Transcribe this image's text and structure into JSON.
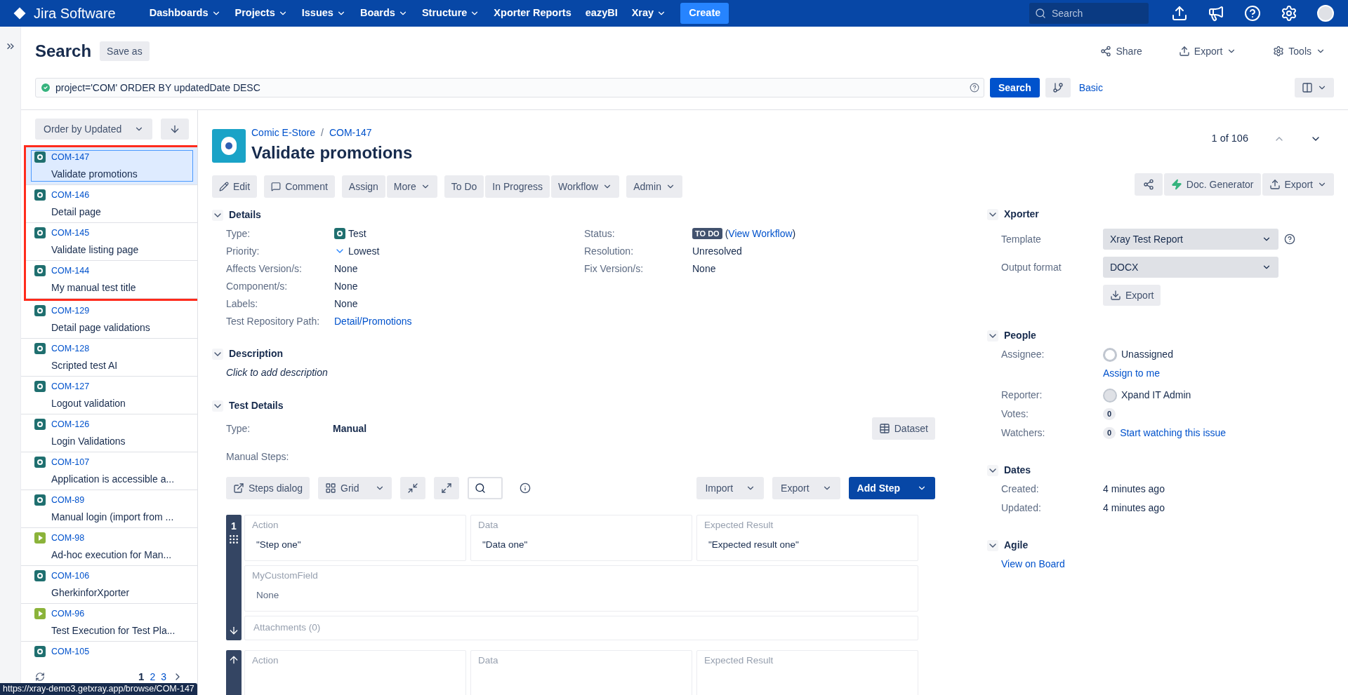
{
  "nav": {
    "logo": "Jira Software",
    "items": [
      {
        "label": "Dashboards",
        "caret": true
      },
      {
        "label": "Projects",
        "caret": true
      },
      {
        "label": "Issues",
        "caret": true
      },
      {
        "label": "Boards",
        "caret": true
      },
      {
        "label": "Structure",
        "caret": true
      },
      {
        "label": "Xporter Reports",
        "caret": false
      },
      {
        "label": "eazyBI",
        "caret": false
      },
      {
        "label": "Xray",
        "caret": true
      }
    ],
    "create": "Create",
    "search_placeholder": "Search"
  },
  "header": {
    "title": "Search",
    "save_as": "Save as",
    "share": "Share",
    "export": "Export",
    "tools": "Tools",
    "query": "project='COM' ORDER BY updatedDate DESC",
    "search_button": "Search",
    "basic": "Basic"
  },
  "list": {
    "order": "Order by Updated",
    "groups": [
      {
        "framed": true,
        "items": [
          {
            "key": "COM-147",
            "title": "Validate promotions",
            "kind": "test",
            "selected": true
          },
          {
            "key": "COM-146",
            "title": "Detail page",
            "kind": "test",
            "selected": false
          },
          {
            "key": "COM-145",
            "title": "Validate listing page",
            "kind": "test",
            "selected": false
          },
          {
            "key": "COM-144",
            "title": "My manual test title",
            "kind": "test",
            "selected": false
          }
        ]
      },
      {
        "framed": false,
        "items": [
          {
            "key": "COM-129",
            "title": "Detail page validations",
            "kind": "test",
            "selected": false
          },
          {
            "key": "COM-128",
            "title": "Scripted test AI",
            "kind": "test",
            "selected": false
          },
          {
            "key": "COM-127",
            "title": "Logout validation",
            "kind": "test",
            "selected": false
          },
          {
            "key": "COM-126",
            "title": "Login Validations",
            "kind": "test",
            "selected": false
          },
          {
            "key": "COM-107",
            "title": "Application is accessible a...",
            "kind": "test",
            "selected": false
          },
          {
            "key": "COM-89",
            "title": "Manual login (import from ...",
            "kind": "test",
            "selected": false
          },
          {
            "key": "COM-98",
            "title": "Ad-hoc execution for Man...",
            "kind": "execution",
            "selected": false
          },
          {
            "key": "COM-106",
            "title": "GherkinforXporter",
            "kind": "test",
            "selected": false
          },
          {
            "key": "COM-96",
            "title": "Test Execution for Test Pla...",
            "kind": "execution",
            "selected": false
          },
          {
            "key": "COM-105",
            "kind": "test",
            "selected": false
          }
        ]
      }
    ],
    "pages": [
      {
        "label": "1",
        "selected": true
      },
      {
        "label": "2",
        "selected": false
      },
      {
        "label": "3",
        "selected": false
      }
    ]
  },
  "issue": {
    "project": "Comic E-Store",
    "separator": "/",
    "key": "COM-147",
    "title": "Validate promotions",
    "pager": "1 of 106",
    "actions": [
      [
        {
          "label": "Edit",
          "kind": "edit",
          "caret": false
        }
      ],
      [
        {
          "label": "Comment",
          "kind": "comment",
          "caret": false
        }
      ],
      [
        {
          "label": "Assign",
          "caret": false
        },
        {
          "label": "More",
          "caret": true
        }
      ],
      [
        {
          "label": "To Do",
          "caret": false
        },
        {
          "label": "In Progress",
          "caret": false
        },
        {
          "label": "Workflow",
          "caret": true
        }
      ],
      [
        {
          "label": "Admin",
          "caret": true
        }
      ]
    ],
    "doc_generator": "Doc. Generator",
    "export": "Export",
    "details_title": "Details",
    "details_left": [
      {
        "label": "Type:",
        "value": "Test",
        "kind": "type"
      },
      {
        "label": "Priority:",
        "value": "Lowest",
        "kind": "priority"
      },
      {
        "label": "Affects Version/s:",
        "value": "None",
        "kind": "text"
      },
      {
        "label": "Component/s:",
        "value": "None",
        "kind": "text"
      },
      {
        "label": "Labels:",
        "value": "None",
        "kind": "text"
      },
      {
        "label": "Test Repository Path:",
        "value": "Detail/Promotions",
        "kind": "link"
      }
    ],
    "details_right": [
      {
        "label": "Status:",
        "value": "TO DO",
        "open": "(",
        "link": "View Workflow",
        "close": ")",
        "kind": "status"
      },
      {
        "label": "Resolution:",
        "value": "Unresolved",
        "kind": "text"
      },
      {
        "label": "Fix Version/s:",
        "value": "None",
        "kind": "text"
      }
    ],
    "description_title": "Description",
    "description": "Click to add description",
    "test_details_title": "Test Details",
    "type_label": "Type:",
    "type_value": "Manual",
    "dataset": "Dataset",
    "manual_steps": "Manual Steps:",
    "steps_toolbar": {
      "dialog": "Steps dialog",
      "grid": "Grid",
      "import": "Import",
      "export": "Export",
      "add": "Add Step"
    },
    "steps": [
      {
        "number": "1",
        "action_label": "Action",
        "action": "\"Step one\"",
        "data_label": "Data",
        "data": "\"Data one\"",
        "result_label": "Expected Result",
        "result": "\"Expected result one\"",
        "custom_label": "MyCustomField",
        "custom": "None",
        "attachments": "Attachments (0)"
      },
      {
        "action_label": "Action",
        "data_label": "Data",
        "result_label": "Expected Result"
      }
    ]
  },
  "side": {
    "xporter": {
      "title": "Xporter",
      "template_label": "Template",
      "template": "Xray Test Report",
      "format_label": "Output format",
      "format": "DOCX",
      "export": "Export"
    },
    "people": {
      "title": "People",
      "assignee_label": "Assignee:",
      "assignee": "Unassigned",
      "assign_me": "Assign to me",
      "reporter_label": "Reporter:",
      "reporter": "Xpand IT Admin",
      "votes_label": "Votes:",
      "votes": "0",
      "watchers_label": "Watchers:",
      "watchers": "0",
      "watch": "Start watching this issue"
    },
    "dates": {
      "title": "Dates",
      "rows": [
        {
          "label": "Created:",
          "value": "4 minutes ago"
        },
        {
          "label": "Updated:",
          "value": "4 minutes ago"
        }
      ]
    },
    "agile": {
      "title": "Agile",
      "link": "View on Board"
    }
  },
  "status_url": "https://xray-demo3.getxray.app/browse/COM-147"
}
